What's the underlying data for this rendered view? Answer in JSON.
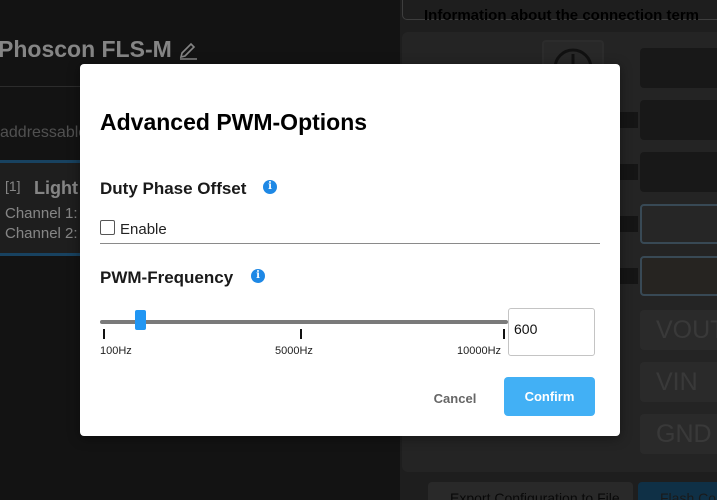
{
  "background": {
    "device_title": "Phoscon FLS-M",
    "addressable_text": "addressable",
    "light": {
      "index": "[1]",
      "name": "Light",
      "channel1": "Channel 1:",
      "channel2": "Channel 2:"
    },
    "info_header": "Information about the connection term",
    "terminal_labels": [
      "VOUT",
      "VIN",
      "GND"
    ],
    "export_button": "Export Configuration to File",
    "flash_button": "Flash Co"
  },
  "modal": {
    "title": "Advanced PWM-Options",
    "duty_phase": {
      "heading": "Duty Phase Offset",
      "info_glyph": "i",
      "checkbox_label": "Enable",
      "checked": false
    },
    "pwm_frequency": {
      "heading": "PWM-Frequency",
      "info_glyph": "i",
      "min_label": "100Hz",
      "mid_label": "5000Hz",
      "max_label": "10000Hz",
      "min": 100,
      "max": 10000,
      "value": 600,
      "input_value": "600"
    },
    "cancel_label": "Cancel",
    "confirm_label": "Confirm"
  },
  "colors": {
    "accent": "#2196f3",
    "confirm_bg": "#42b0f5",
    "info_icon": "#1e88e5",
    "highlight_border": "#2e7fb8"
  },
  "icons": {
    "edit": "pencil-icon",
    "info": "info-icon",
    "connector": "power-connector-icon"
  }
}
